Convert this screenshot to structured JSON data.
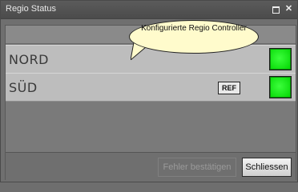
{
  "window": {
    "title": "Regio Status",
    "controls": {
      "maximize_icon": "maximize-icon",
      "close_icon": "close-icon"
    }
  },
  "tooltip": {
    "text": "Konfigurierte Regio Controller",
    "bg_color": "#fffbcc"
  },
  "rows": [
    {
      "label": "NORD",
      "badge": "",
      "status": "green"
    },
    {
      "label": "SÜD",
      "badge": "REF",
      "status": "green"
    }
  ],
  "buttons": {
    "acknowledge_errors": "Fehler bestätigen",
    "close": "Schliessen"
  },
  "colors": {
    "status_ok": "#22e022",
    "panel_bg": "#bdbdbd",
    "window_bg": "#6f6f6f"
  }
}
